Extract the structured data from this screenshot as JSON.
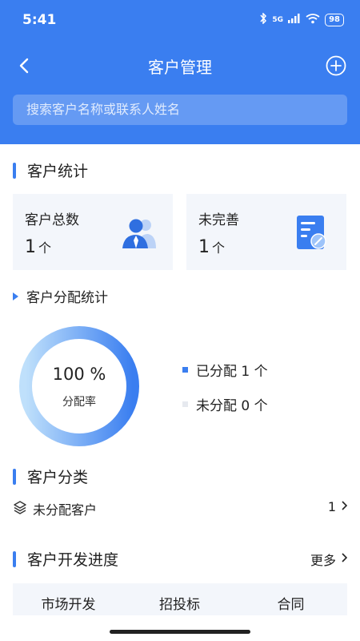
{
  "status_bar": {
    "time": "5:41",
    "network": "5G",
    "battery": "98"
  },
  "nav": {
    "title": "客户管理"
  },
  "search": {
    "placeholder": "搜索客户名称或联系人姓名"
  },
  "stats_section": {
    "title": "客户统计",
    "cards": [
      {
        "label": "客户总数",
        "value": "1",
        "unit": "个",
        "icon": "users-icon"
      },
      {
        "label": "未完善",
        "value": "1",
        "unit": "个",
        "icon": "form-edit-icon"
      }
    ]
  },
  "distribution": {
    "title": "客户分配统计",
    "percent_text": "100 %",
    "rate_label": "分配率",
    "rate": 1.0,
    "legend": [
      {
        "label": "已分配 1 个",
        "color": "#3a7ef0"
      },
      {
        "label": "未分配 0 个",
        "color": "#e6e9ef"
      }
    ],
    "colors": {
      "ring_start": "#bfe0fb",
      "ring_end": "#3a7ef0"
    }
  },
  "category_section": {
    "title": "客户分类",
    "items": [
      {
        "icon": "layers-icon",
        "label": "未分配客户",
        "count": "1"
      }
    ]
  },
  "progress_section": {
    "title": "客户开发进度",
    "more": "更多",
    "tabs": [
      "市场开发",
      "招投标",
      "合同"
    ]
  },
  "theme": {
    "primary": "#3a7ef0",
    "card_bg": "#f3f6fb"
  }
}
